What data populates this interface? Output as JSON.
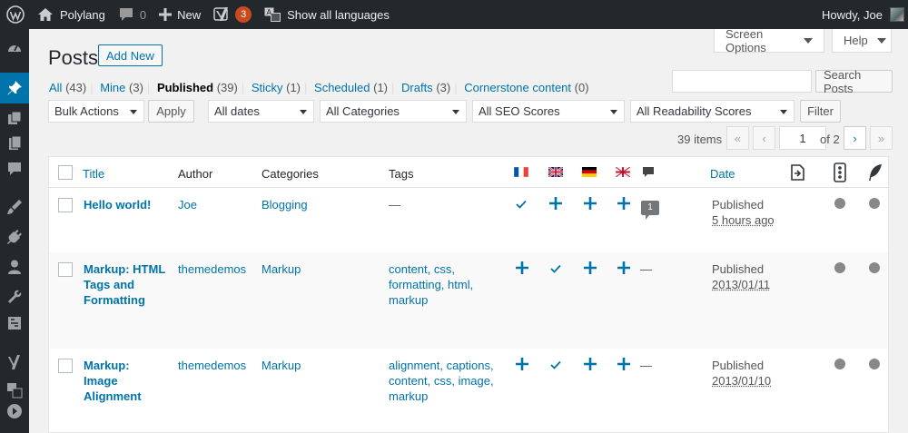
{
  "adminbar": {
    "site_name": "Polylang",
    "comments_count": "0",
    "new_label": "New",
    "yoast_badge": "3",
    "languages_label": "Show all languages",
    "howdy": "Howdy, Joe"
  },
  "screen_options": {
    "screen_options_label": "Screen Options",
    "help_label": "Help"
  },
  "page": {
    "title": "Posts",
    "add_new": "Add New"
  },
  "views": [
    {
      "label": "All",
      "count": "(43)",
      "current": false
    },
    {
      "label": "Mine",
      "count": "(3)",
      "current": false
    },
    {
      "label": "Published",
      "count": "(39)",
      "current": true
    },
    {
      "label": "Sticky",
      "count": "(1)",
      "current": false
    },
    {
      "label": "Scheduled",
      "count": "(1)",
      "current": false
    },
    {
      "label": "Drafts",
      "count": "(3)",
      "current": false
    },
    {
      "label": "Cornerstone content",
      "count": "(0)",
      "current": false
    }
  ],
  "search": {
    "button": "Search Posts"
  },
  "filters": {
    "bulk_actions": "Bulk Actions",
    "apply": "Apply",
    "dates": "All dates",
    "categories": "All Categories",
    "seo_scores": "All SEO Scores",
    "readability": "All Readability Scores",
    "filter": "Filter"
  },
  "pagination": {
    "items": "39 items",
    "first": "«",
    "prev": "‹",
    "current_page": "1",
    "of_total": "of 2",
    "next": "›",
    "last": "»"
  },
  "table": {
    "columns": {
      "title": "Title",
      "author": "Author",
      "categories": "Categories",
      "tags": "Tags",
      "date": "Date"
    },
    "flags": [
      "fr-flag-icon",
      "en-flag-icon",
      "de-flag-icon",
      "en-gb-flag-icon"
    ],
    "rows": [
      {
        "title_lines": [
          "Hello world!"
        ],
        "author": "Joe",
        "category": "Blogging",
        "tags_lines": [
          "—"
        ],
        "translations": [
          "check",
          "plus",
          "plus",
          "plus"
        ],
        "comments": "1",
        "status": "Published",
        "date": "5 hours ago"
      },
      {
        "title_lines": [
          "Markup: HTML",
          "Tags and",
          "Formatting"
        ],
        "author": "themedemos",
        "category": "Markup",
        "tags_lines": [
          "content, css,",
          "formatting, html,",
          "markup"
        ],
        "translations": [
          "plus",
          "check",
          "plus",
          "plus"
        ],
        "comments": "—",
        "status": "Published",
        "date": "2013/01/11"
      },
      {
        "title_lines": [
          "Markup:",
          "Image",
          "Alignment"
        ],
        "author": "themedemos",
        "category": "Markup",
        "tags_lines": [
          "alignment, captions,",
          "content, css, image,",
          "markup"
        ],
        "translations": [
          "plus",
          "check",
          "plus",
          "plus"
        ],
        "comments": "—",
        "status": "Published",
        "date": "2013/01/10"
      }
    ]
  },
  "colors": {
    "accent": "#0073aa",
    "adminbar": "#23282d",
    "badge": "#ca4a1f",
    "seo_dot": "#888888"
  }
}
